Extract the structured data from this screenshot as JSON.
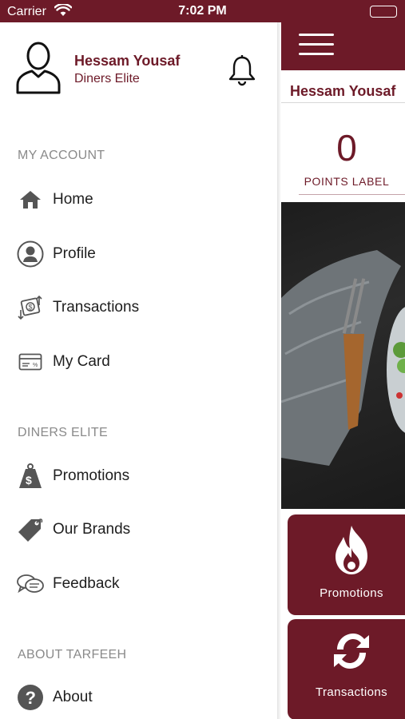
{
  "status_bar": {
    "carrier": "Carrier",
    "time": "7:02 PM"
  },
  "drawer": {
    "user": {
      "name": "Hessam Yousaf",
      "tier": "Diners Elite"
    },
    "sections": [
      {
        "title": "MY ACCOUNT",
        "items": [
          {
            "label": "Home",
            "icon": "home-icon"
          },
          {
            "label": "Profile",
            "icon": "profile-icon"
          },
          {
            "label": "Transactions",
            "icon": "transactions-icon"
          },
          {
            "label": "My Card",
            "icon": "card-icon"
          }
        ]
      },
      {
        "title": "DINERS ELITE",
        "items": [
          {
            "label": "Promotions",
            "icon": "price-tag-dollar-icon"
          },
          {
            "label": "Our Brands",
            "icon": "tag-icon"
          },
          {
            "label": "Feedback",
            "icon": "chat-bubbles-icon"
          }
        ]
      },
      {
        "title": "ABOUT TARFEEH",
        "items": [
          {
            "label": "About",
            "icon": "question-icon"
          }
        ]
      }
    ]
  },
  "main": {
    "user_name": "Hessam Yousaf",
    "points": "0",
    "points_label": "POINTS LABEL",
    "tiles": [
      {
        "label": "Promotions",
        "icon": "flame-icon"
      },
      {
        "label": "Transactions",
        "icon": "refresh-icon"
      }
    ]
  },
  "colors": {
    "brand": "#6d1a28",
    "muted": "#8a8a8a"
  }
}
